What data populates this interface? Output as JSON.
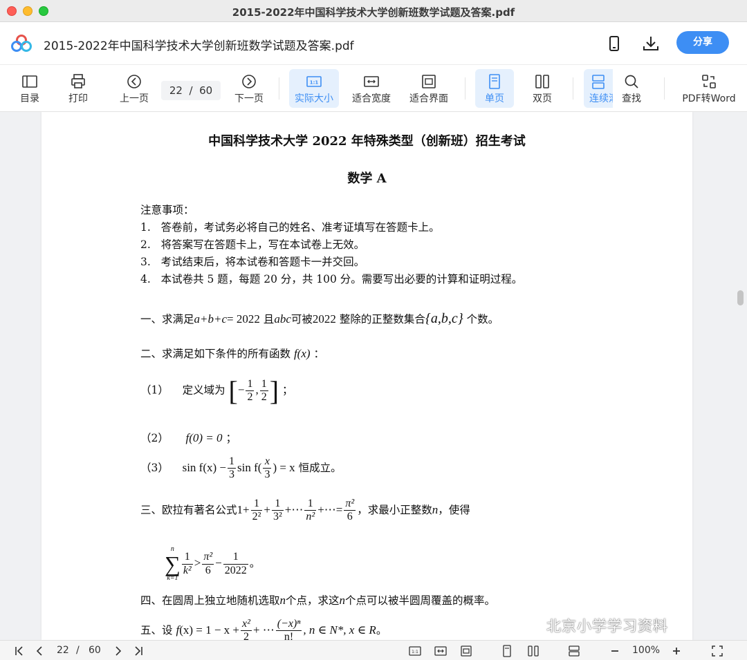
{
  "window": {
    "title": "2015-2022年中国科学技术大学创新班数学试题及答案.pdf"
  },
  "header": {
    "doc_title": "2015-2022年中国科学技术大学创新班数学试题及答案.pdf",
    "share_label": "分享",
    "icons": [
      "logo-icon",
      "phone-icon",
      "download-icon"
    ]
  },
  "toolbar": {
    "toc": "目录",
    "print": "打印",
    "prev": "上一页",
    "current_page": "22",
    "page_sep": "/",
    "total_pages": "60",
    "next": "下一页",
    "actual_size": "实际大小",
    "fit_width": "适合宽度",
    "fit_window": "适合界面",
    "single": "单页",
    "double": "双页",
    "continuous": "连续滚",
    "find": "查找",
    "pdf_word": "PDF转Word"
  },
  "document": {
    "title": "中国科学技术大学 2022 年特殊类型（创新班）招生考试",
    "subtitle": "数学 A",
    "notice_heading": "注意事项：",
    "notices": [
      "1.   答卷前，考试务必将自己的姓名、准考证填写在答题卡上。",
      "2.   将答案写在答题卡上，写在本试卷上无效。",
      "3.   考试结束后，将本试卷和答题卡一并交回。",
      "4.   本试卷共 5 题，每题 20 分，共 100 分。需要写出必要的计算和证明过程。"
    ],
    "q1_prefix": "一、求满足",
    "q1_eq": "a+b+c",
    "q1_eq2": "= 2022",
    "q1_mid": "且",
    "q1_abc": "abc",
    "q1_mid2": "可被",
    "q1_num": "2022",
    "q1_mid3": "整除的正整数集合",
    "q1_set": "{a,b,c}",
    "q1_suffix": "个数。",
    "q2_prefix": "二、求满足如下条件的所有函数",
    "q2_fx": "f(x)",
    "q2_suffix": "：",
    "c1_label": "（1）",
    "c1_text": "定义域为",
    "c1_end": "；",
    "c2_label": "（2）",
    "c2_text": "f(0) = 0",
    "c2_end": "；",
    "c3_label": "（3）",
    "c3_text1": "sin f(x) −",
    "c3_text2": "sin f(",
    "c3_text3": ") = x",
    "c3_end": "恒成立。",
    "q3_prefix": "三、欧拉有著名公式",
    "q3_suffix": "，求最小正整数",
    "q3_n": "n",
    "q3_end": "，使得",
    "q3b_end": "。",
    "q4": "四、在圆周上独立地随机选取",
    "q4_n": "n",
    "q4_mid": "个点，求这",
    "q4_n2": "n",
    "q4_end": "个点可以被半圆周覆盖的概率。",
    "q5_prefix": "五、设",
    "q5_text": "f",
    "q5_eq": "(x) = 1 − x +",
    "q5_mid": "+ ⋯",
    "q5_tail": ", n ∈ N*, x ∈ R",
    "q5_end": "。"
  },
  "watermark": "北京小学学习资料",
  "statusbar": {
    "current_page": "22",
    "sep": "/",
    "total": "60",
    "zoom": "100%"
  }
}
